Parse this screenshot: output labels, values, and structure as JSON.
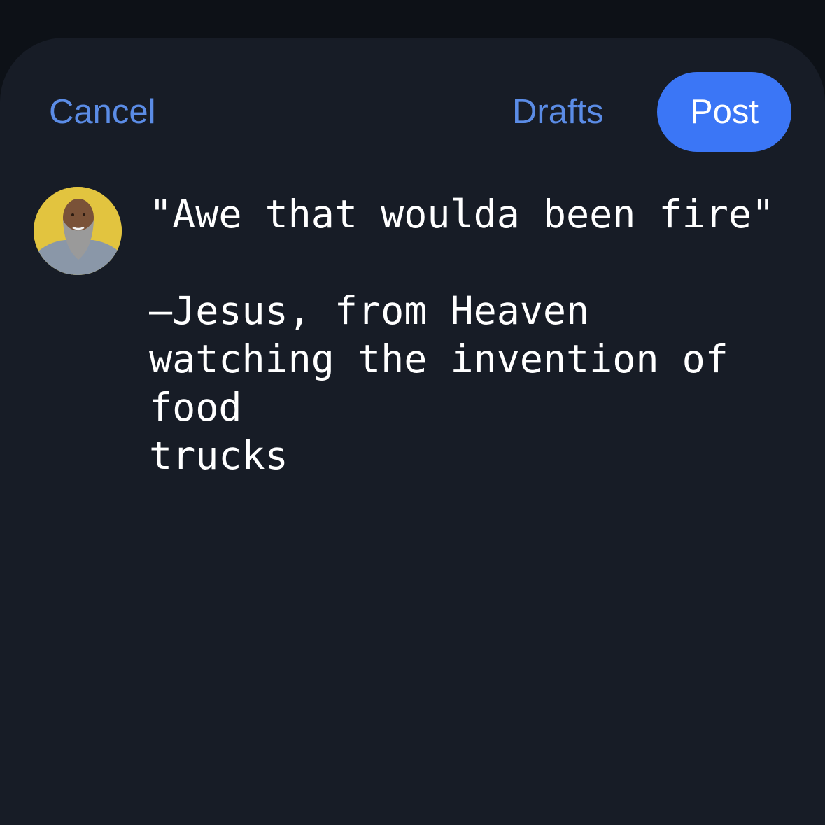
{
  "header": {
    "cancel_label": "Cancel",
    "drafts_label": "Drafts",
    "post_label": "Post"
  },
  "composer": {
    "avatar_icon": "user-avatar-photo",
    "text": "\"Awe that woulda been fire\"\n\n–Jesus, from Heaven\nwatching the invention of food\ntrucks"
  },
  "colors": {
    "background": "#171c26",
    "accent": "#3b76f6",
    "link": "#5b8ce6",
    "text": "#ffffff"
  }
}
